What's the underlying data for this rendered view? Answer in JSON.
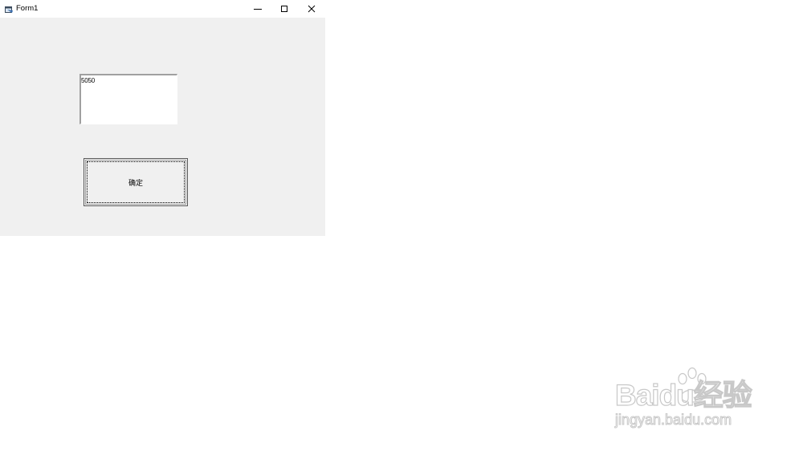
{
  "window": {
    "title": "Form1",
    "controls": {
      "minimize_icon": "minimize-icon",
      "maximize_icon": "maximize-icon",
      "close_icon": "close-icon"
    }
  },
  "form": {
    "textbox_value": "5050",
    "button_label": "确定"
  },
  "watermark": {
    "logo": "Baidu经验",
    "url": "jingyan.baidu.com"
  },
  "colors": {
    "form_background": "#f0f0f0",
    "titlebar_background": "#ffffff"
  }
}
